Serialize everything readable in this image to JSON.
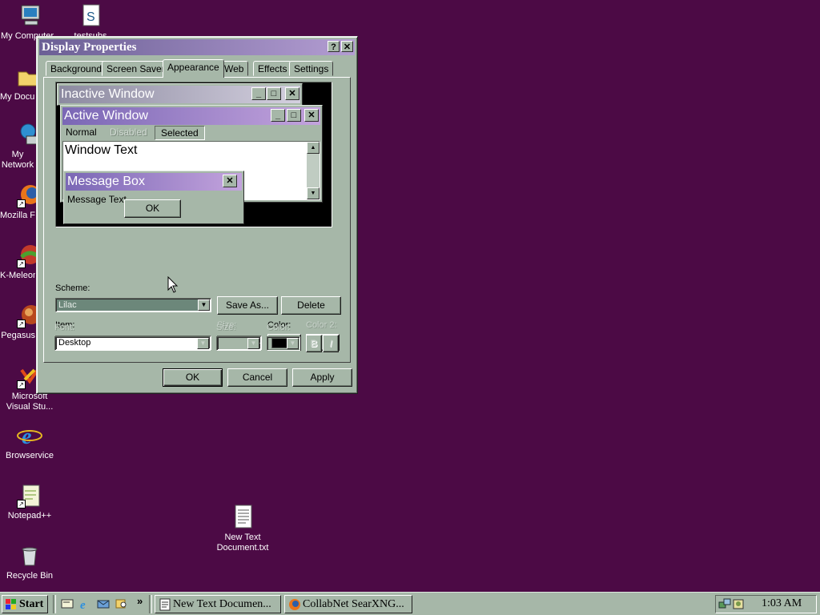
{
  "desktop": {
    "icons": [
      {
        "label": "My Computer"
      },
      {
        "label": "testsubs"
      },
      {
        "label": "My Documents"
      },
      {
        "label": "My Network Places"
      },
      {
        "label": "Mozilla Firefox"
      },
      {
        "label": "K-Meleon"
      },
      {
        "label": "Pegasus"
      },
      {
        "label": "Microsoft Visual Stu..."
      },
      {
        "label": "Browservice"
      },
      {
        "label": "Notepad++"
      },
      {
        "label": "Recycle Bin"
      },
      {
        "label": "New Text Document.txt"
      }
    ],
    "background_color": "#4c0a45"
  },
  "dialog": {
    "title": "Display Properties",
    "help_button": "?",
    "close_button": "✕",
    "tabs": [
      "Background",
      "Screen Saver",
      "Appearance",
      "Web",
      "Effects",
      "Settings"
    ],
    "active_tab": "Appearance",
    "preview": {
      "inactive_title": "Inactive Window",
      "active_title": "Active Window",
      "menu": [
        "Normal",
        "Disabled",
        "Selected"
      ],
      "window_text": "Window Text",
      "message_box_title": "Message Box",
      "message_text": "Message Text",
      "ok": "OK"
    },
    "scheme_label": "Scheme:",
    "scheme_value": "Lilac",
    "save_as": "Save As...",
    "delete": "Delete",
    "item_label": "Item:",
    "item_value": "Desktop",
    "size_label": "Size:",
    "color_label": "Color:",
    "color2_label": "Color 2:",
    "font_label": "Font:",
    "font_size_label": "Size:",
    "font_color_label": "Color:",
    "bold": "B",
    "italic": "I",
    "selected_color": "#000000",
    "ok": "OK",
    "cancel": "Cancel",
    "apply": "Apply"
  },
  "taskbar": {
    "start": "Start",
    "more": "»",
    "tasks": [
      "New Text Documen...",
      "CollabNet SearXNG..."
    ],
    "clock": "1:03 AM"
  }
}
